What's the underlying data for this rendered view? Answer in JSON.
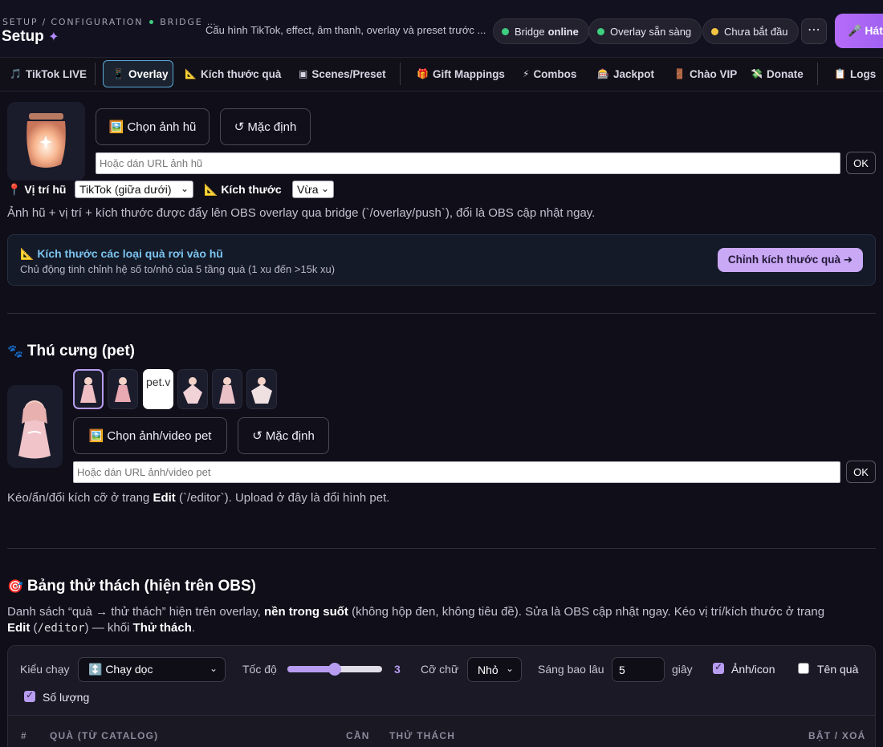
{
  "header": {
    "breadcrumb_left": "SETUP / CONFIGURATION",
    "breadcrumb_right": "BRIDGE …",
    "title": "Setup",
    "subtitle": "Cấu hình TikTok, effect, âm thanh, overlay và preset trước ...",
    "status": [
      {
        "label": "Bridge",
        "value": "online",
        "color": "#3ecf7f"
      },
      {
        "label": "Overlay sẵn sàng",
        "value": "",
        "color": "#3ecf7f"
      },
      {
        "label": "Chưa bắt đầu",
        "value": "",
        "color": "#f5c542"
      }
    ],
    "more_label": "⋯",
    "cta_label": "🎤 Hát"
  },
  "tabs": [
    {
      "icon": "🎵",
      "label": "TikTok LIVE"
    },
    {
      "icon": "📱",
      "label": "Overlay"
    },
    {
      "icon": "📐",
      "label": "Kích thước quà"
    },
    {
      "icon": "▣",
      "label": "Scenes/Preset"
    },
    {
      "icon": "🎁",
      "label": "Gift Mappings"
    },
    {
      "icon": "⚡",
      "label": "Combos"
    },
    {
      "icon": "🎰",
      "label": "Jackpot"
    },
    {
      "icon": "🚪",
      "label": "Chào VIP"
    },
    {
      "icon": "💸",
      "label": "Donate"
    },
    {
      "icon": "📋",
      "label": "Logs"
    }
  ],
  "jar": {
    "choose_label": "🖼️ Chọn ảnh hũ",
    "default_label": "↺ Mặc định",
    "url_placeholder": "Hoặc dán URL ảnh hũ",
    "ok_label": "OK",
    "position_label": "📍 Vị trí hũ",
    "position_value": "TikTok (giữa dưới)",
    "size_label": "📐 Kích thước",
    "size_value": "Vừa",
    "desc": "Ảnh hũ + vị trí + kích thước được đẩy lên OBS overlay qua bridge (`/overlay/push`), đổi là OBS cập nhật ngay."
  },
  "gift_size_box": {
    "title": "📐 Kích thước các loại quà rơi vào hũ",
    "desc": "Chủ động tinh chỉnh hệ số to/nhỏ của 5 tầng quà (1 xu đến >15k xu)",
    "button": "Chỉnh kích thước quà ➜"
  },
  "pet": {
    "title": "Thú cưng (pet)",
    "icon": "🐾",
    "broken_thumb_text": "pet.v",
    "choose_label": "🖼️ Chọn ảnh/video pet",
    "default_label": "↺ Mặc định",
    "url_placeholder": "Hoặc dán URL ảnh/video pet",
    "ok_label": "OK",
    "desc_1": "Kéo/ẩn/đổi kích cỡ ở trang ",
    "desc_bold": "Edit",
    "desc_2": " (`/editor`). Upload ở đây là đổi hình pet."
  },
  "challenge": {
    "icon": "🎯",
    "title": "Bảng thử thách (hiện trên OBS)",
    "desc_a": "Danh sách “quà → thử thách” hiện trên overlay, ",
    "desc_b": "nền trong suốt",
    "desc_c": " (không hộp đen, không tiêu đề). Sửa là OBS cập nhật ngay. Kéo vị trí/kích thước ở trang",
    "desc_d": "Edit",
    "desc_e": " (",
    "desc_code": "/editor",
    "desc_f": ") — khối ",
    "desc_g": "Thử thách",
    "desc_h": ".",
    "mode_label": "Kiểu chạy",
    "mode_value": "↕️ Chạy dọc",
    "speed_label": "Tốc độ",
    "speed_value": "3",
    "speed_fraction": 0.5,
    "font_label": "Cỡ chữ",
    "font_value": "Nhỏ",
    "duration_label": "Sáng bao lâu",
    "duration_value": "5",
    "duration_unit": "giây",
    "opt_image": "Ảnh/icon",
    "opt_image_on": true,
    "opt_name": "Tên quà",
    "opt_name_on": false,
    "opt_qty": "Số lượng",
    "opt_qty_on": true,
    "columns": [
      "#",
      "QUÀ (TỪ CATALOG)",
      "CẦN",
      "THỬ THÁCH",
      "BẬT / XOÁ"
    ]
  }
}
